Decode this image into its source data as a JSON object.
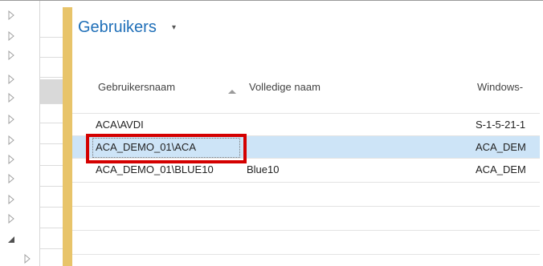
{
  "header": {
    "title": "Gebruikers",
    "title_caret": "▾"
  },
  "grid": {
    "columns": [
      {
        "label": "Gebruikersnaam",
        "sorted": "ascending"
      },
      {
        "label": "Volledige naam"
      },
      {
        "label": "Windows-"
      }
    ],
    "rows": [
      {
        "username": "ACA\\AVDI",
        "full_name": "",
        "windows": "S-1-5-21-1",
        "selected": false
      },
      {
        "username": "ACA_DEMO_01\\ACA",
        "full_name": "",
        "windows": "ACA_DEM",
        "selected": true
      },
      {
        "username": "ACA_DEMO_01\\BLUE10",
        "full_name": "Blue10",
        "windows": "ACA_DEM",
        "selected": false
      }
    ]
  },
  "tree": {
    "icons": [
      "triangle-right-icon",
      "triangle-right-icon",
      "triangle-right-icon",
      "triangle-right-icon",
      "triangle-right-icon",
      "triangle-right-icon",
      "triangle-right-icon",
      "triangle-right-icon",
      "triangle-right-icon",
      "triangle-right-icon",
      "triangle-right-icon",
      "triangle-right-icon",
      "triangle-down-icon"
    ]
  },
  "colors": {
    "title": "#1f6fb8",
    "accent_bar": "#e8c46a",
    "selected_row": "#cde4f7",
    "highlight": "#d40000"
  }
}
